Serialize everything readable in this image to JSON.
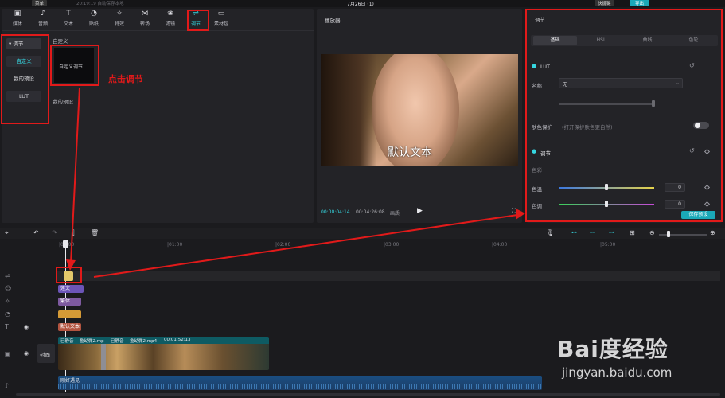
{
  "topbar": {
    "menu_label": "菜单",
    "autosave_text": "20:19:19 自动保存本地",
    "title": "7月26日 (1)",
    "shortcut_label": "快捷键",
    "export_label": "导出"
  },
  "toolbar": [
    {
      "icon": "media-icon",
      "glyph": "▣",
      "label": "媒体"
    },
    {
      "icon": "audio-icon",
      "glyph": "♪",
      "label": "音频"
    },
    {
      "icon": "text-icon",
      "glyph": "T",
      "label": "文本"
    },
    {
      "icon": "sticker-icon",
      "glyph": "◔",
      "label": "贴纸"
    },
    {
      "icon": "effects-icon",
      "glyph": "✧",
      "label": "特效"
    },
    {
      "icon": "transition-icon",
      "glyph": "⋈",
      "label": "转场"
    },
    {
      "icon": "filter-icon",
      "glyph": "❀",
      "label": "滤镜"
    },
    {
      "icon": "adjust-icon",
      "glyph": "⇌",
      "label": "调节"
    },
    {
      "icon": "material-pack-icon",
      "glyph": "▭",
      "label": "素材包"
    }
  ],
  "sidebar": {
    "header": "▾ 调节",
    "items": [
      "自定义",
      "我的预设",
      "LUT"
    ]
  },
  "custom": {
    "section_label": "自定义",
    "card_label": "自定义调节",
    "presets_label": "我的预设"
  },
  "annotation": "点击调节",
  "player": {
    "title": "播放器",
    "overlay_text": "默认文本",
    "time_current": "00:00:04:14",
    "time_total": "00:04:26:08",
    "quality": "画质"
  },
  "adjust_panel": {
    "title": "调节",
    "tabs": [
      "基础",
      "HSL",
      "曲线",
      "色轮"
    ],
    "lut_label": "LUT",
    "name_label": "名称",
    "name_value": "无",
    "skin_label": "肤色保护",
    "skin_hint": "(打开保护肤色更自然)",
    "adjust_label": "调节",
    "color_label": "色彩",
    "temperature_label": "色温",
    "temperature_value": "0",
    "tint_label": "色调",
    "tint_value": "0",
    "save_preset": "保存预设"
  },
  "timeline": {
    "ticks": [
      "|00:00",
      "|01:00",
      "|02:00",
      "|03:00",
      "|04:00",
      "|05:00"
    ],
    "chips": [
      "莲文",
      "繁体",
      "",
      "默认文本"
    ],
    "video_labels": [
      "已静音",
      "鱼幼微2.mp",
      "已静音",
      "鱼幼微2.mp4",
      "00:01:52:13"
    ],
    "cover_label": "封面",
    "audio_label": "刚好遇见"
  },
  "watermark": {
    "brand": "Bai度经验",
    "url": "jingyan.baidu.com"
  }
}
